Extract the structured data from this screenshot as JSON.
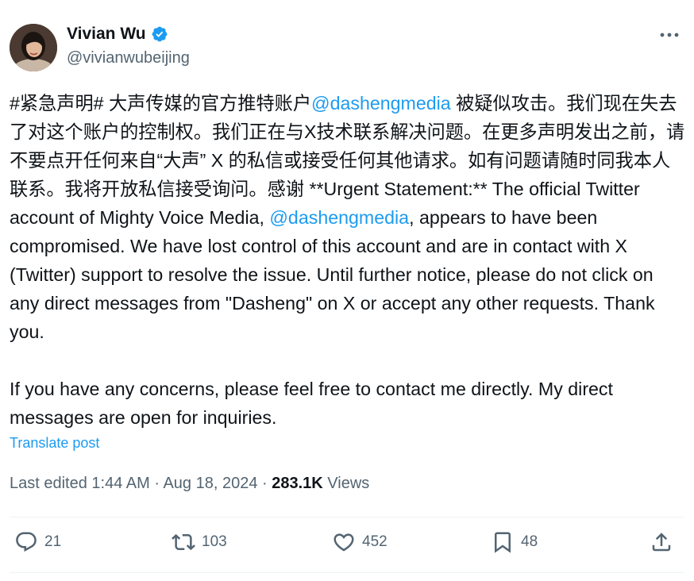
{
  "author": {
    "name": "Vivian Wu",
    "handle": "@vivianwubeijing",
    "verified": true,
    "avatar_icon": "avatar"
  },
  "more_icon": "more-horizontal-icon",
  "post": {
    "seg1": "#紧急声明# 大声传媒的官方推特账户",
    "mention1": "@dashengmedia",
    "seg2": " 被疑似攻击。我们现在失去了对这个账户的控制权。我们正在与X技术联系解决问题。在更多声明发出之前，请不要点开任何来自“大声” X 的私信或接受任何其他请求。如有问题请随时同我本人联系。我将开放私信接受询问。感谢 **Urgent Statement:** The official Twitter account of Mighty Voice Media, ",
    "mention2": "@dashengmedia",
    "seg3": ", appears to have been compromised. We have lost control of this account and are in contact with X (Twitter) support to resolve the issue. Until further notice, please do not click on any direct messages from \"Dasheng\" on X or accept any other requests. Thank you.\n\nIf you have any concerns, please feel free to contact me directly. My direct messages are open for inquiries."
  },
  "translate_label": "Translate post",
  "meta": {
    "edited_time": "Last edited 1:44 AM",
    "sep": " · ",
    "date": "Aug 18, 2024",
    "views_count": "283.1K",
    "views_label": " Views"
  },
  "actions": {
    "replies": "21",
    "reposts": "103",
    "likes": "452",
    "bookmarks": "48"
  },
  "colors": {
    "accent": "#1d9bf0",
    "secondary_text": "#536471",
    "primary_text": "#0f1419",
    "divider": "#eff3f4"
  }
}
